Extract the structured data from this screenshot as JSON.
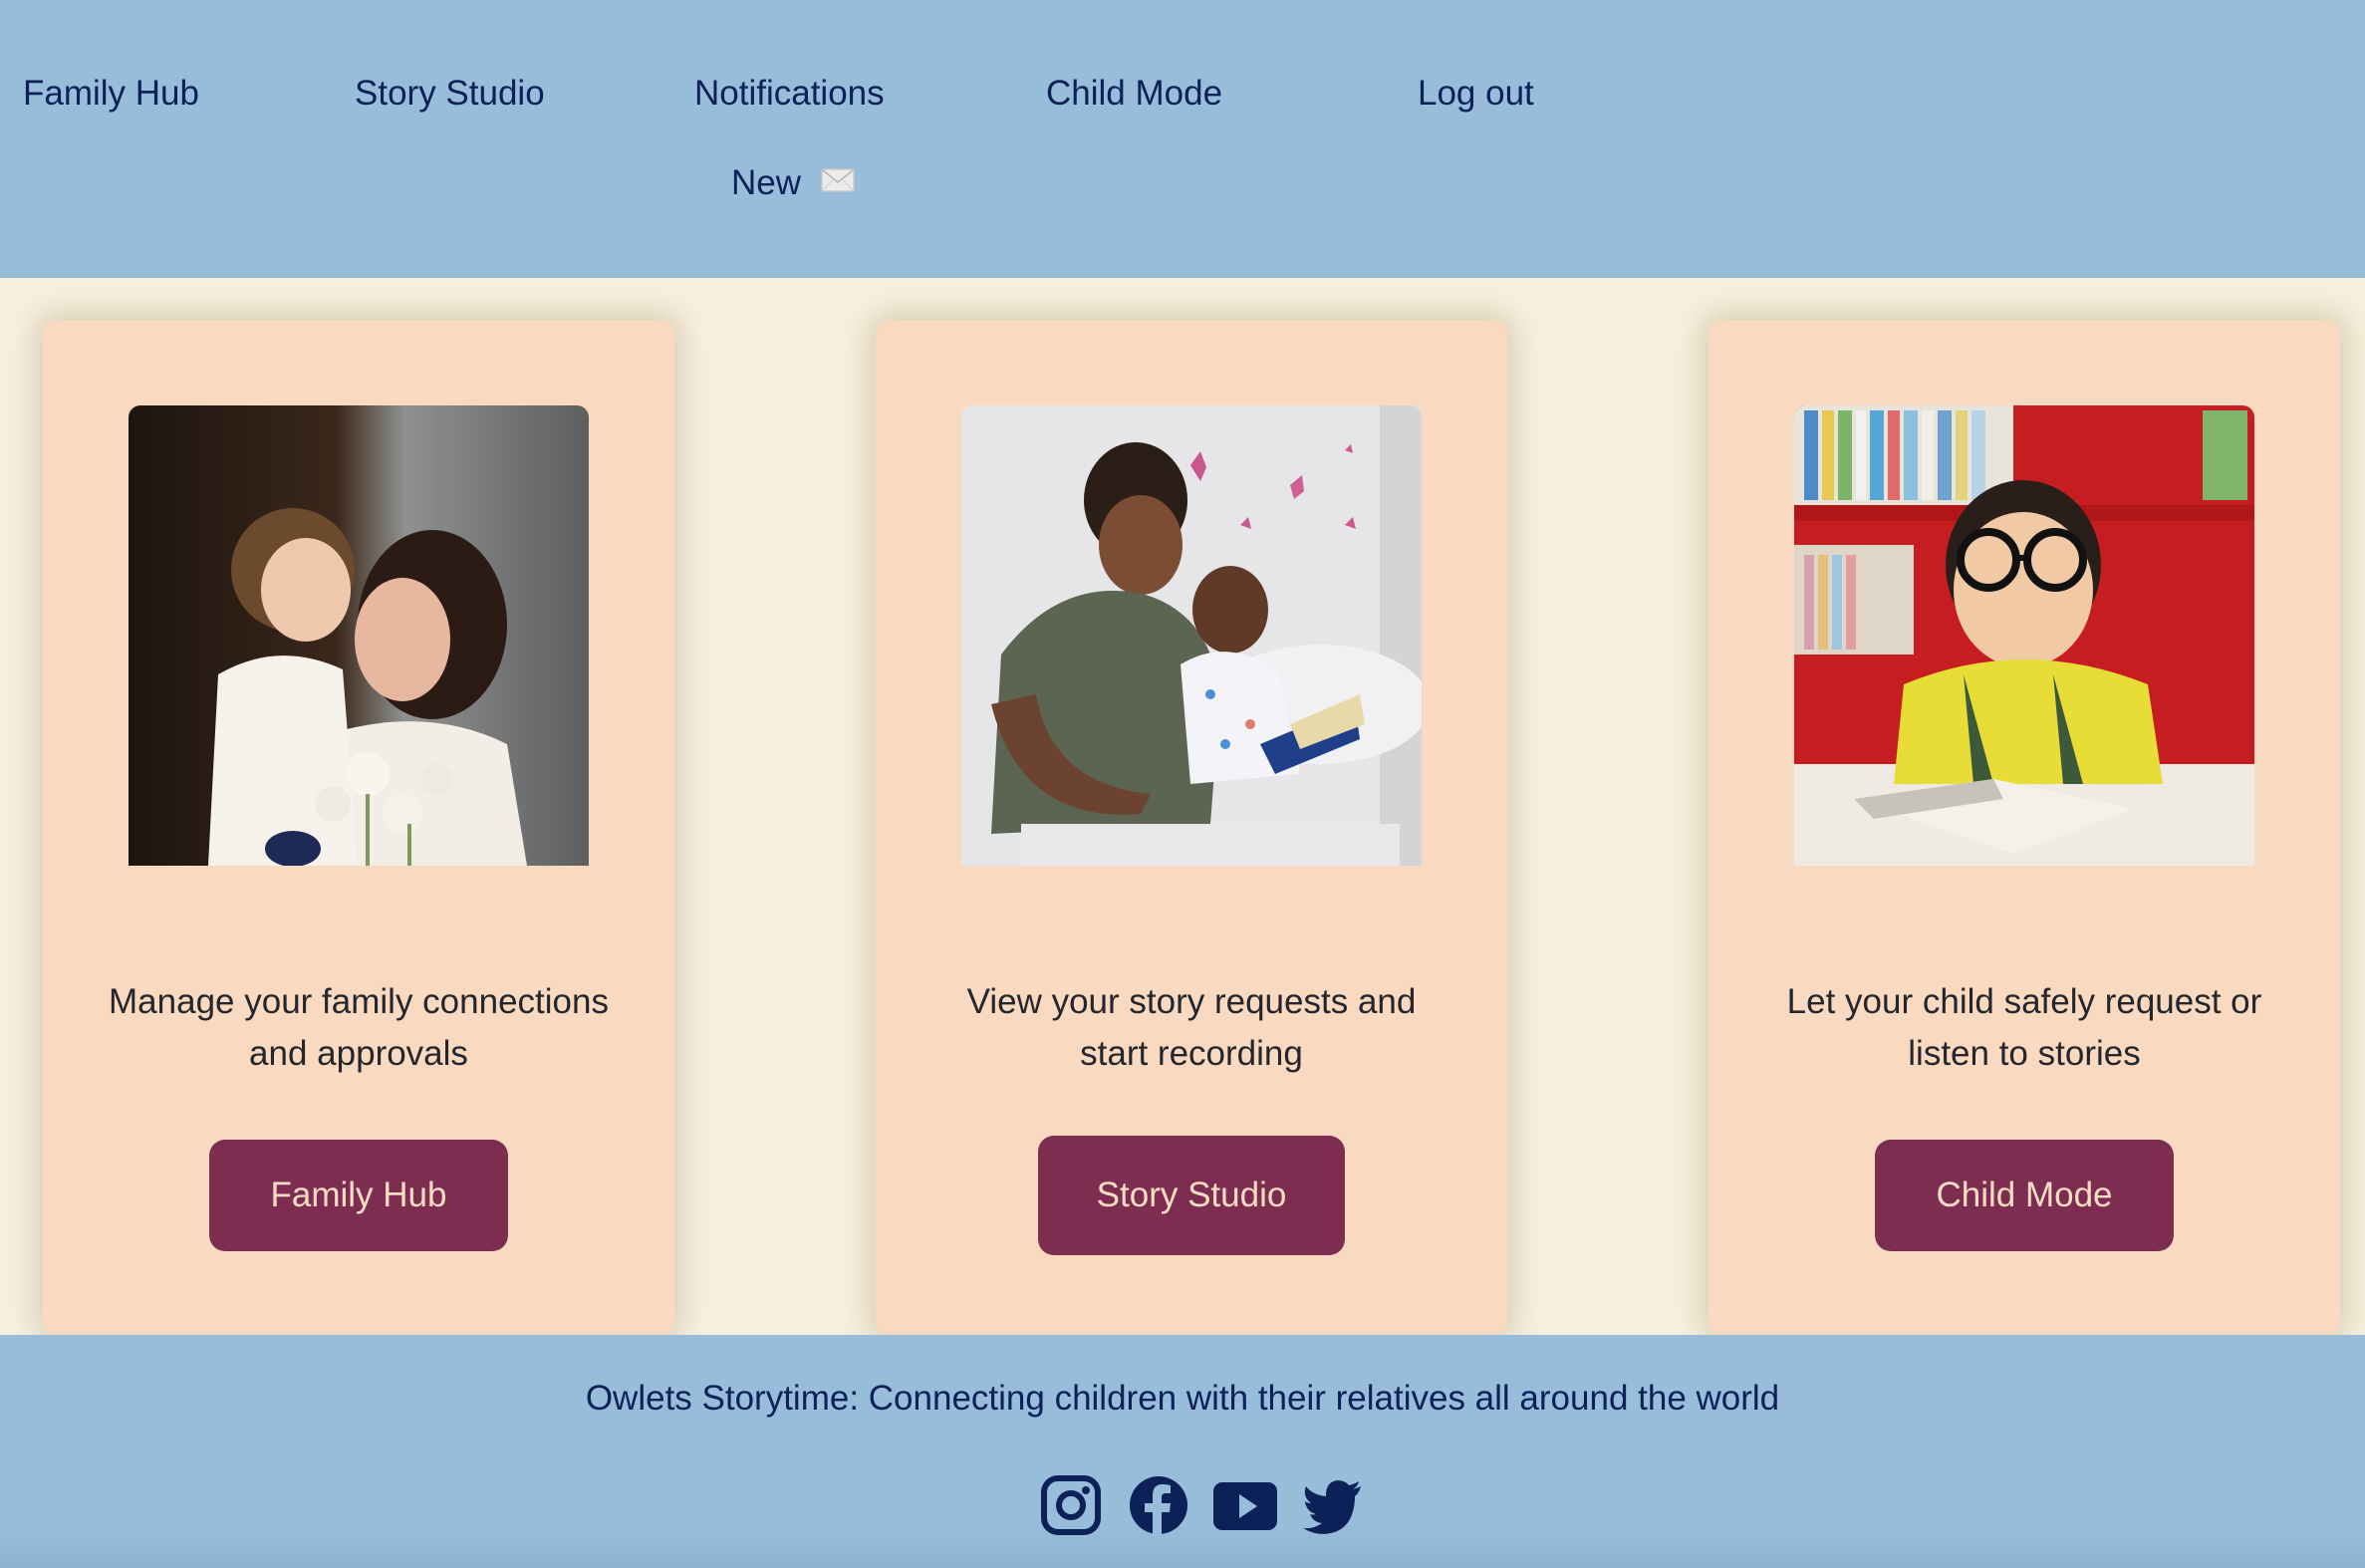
{
  "header": {
    "nav": [
      {
        "label": "Family Hub"
      },
      {
        "label": "Story Studio"
      },
      {
        "label": "Notifications"
      },
      {
        "label": "Child Mode"
      },
      {
        "label": "Log out"
      }
    ],
    "notification_badge": {
      "label": "New",
      "icon": "envelope-icon"
    }
  },
  "cards": [
    {
      "image_alt": "Mother and daughter touching noses with tulips in foreground",
      "description": "Manage your family connections and approvals",
      "button_label": "Family Hub"
    },
    {
      "image_alt": "Father reading a book with his young child on a bed",
      "description": "View your story requests and start recording",
      "button_label": "Story Studio"
    },
    {
      "image_alt": "Young boy with round glasses lying on the floor reading in front of a red bookshelf",
      "description": "Let your child safely request or listen to stories",
      "button_label": "Child Mode"
    }
  ],
  "footer": {
    "tagline": "Owlets Storytime: Connecting children with their relatives all around the world",
    "social": [
      {
        "name": "instagram-icon"
      },
      {
        "name": "facebook-icon"
      },
      {
        "name": "youtube-icon"
      },
      {
        "name": "twitter-icon"
      }
    ]
  },
  "colors": {
    "header_bg": "#97bddb",
    "page_bg": "#f8efdc",
    "card_bg": "#f9dac1",
    "button_bg": "#7d2e50",
    "button_text": "#fbdcc4",
    "nav_text": "#0c2157",
    "body_text": "#24262b"
  }
}
